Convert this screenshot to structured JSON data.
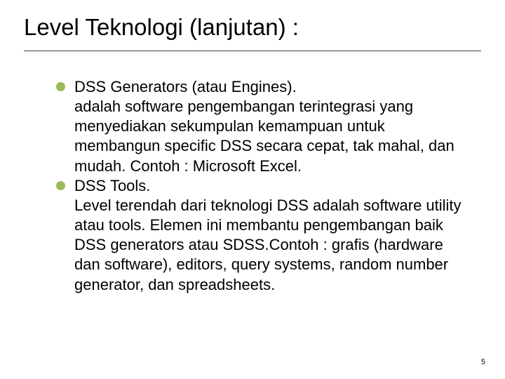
{
  "title": "Level Teknologi (lanjutan) :",
  "bullets": [
    {
      "heading": "DSS Generators (atau Engines).",
      "desc": "adalah software pengembangan terintegrasi yang menyediakan sekumpulan kemampuan untuk membangun specific DSS secara cepat, tak mahal, dan mudah.   Contoh : Microsoft Excel."
    },
    {
      "heading": "DSS Tools.",
      "desc": "Level terendah dari teknologi DSS adalah software utility atau tools. Elemen ini membantu pengembangan baik DSS generators atau SDSS.Contoh : grafis (hardware dan software), editors, query systems, random number generator, dan spreadsheets."
    }
  ],
  "page_number": "5",
  "accent_color": "#9BBB59"
}
